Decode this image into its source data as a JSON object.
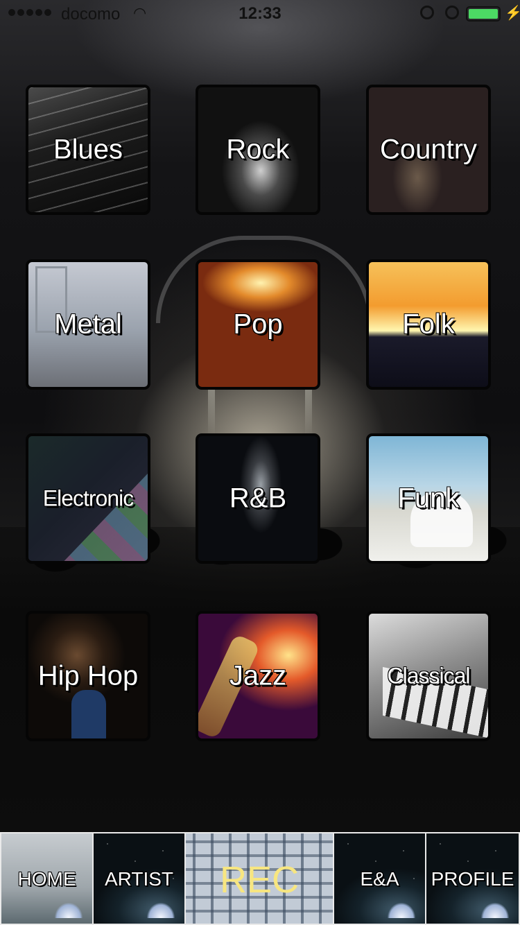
{
  "status_bar": {
    "carrier": "docomo",
    "time": "12:33",
    "battery_level": 1.0
  },
  "genres": [
    {
      "label": "Blues"
    },
    {
      "label": "Rock"
    },
    {
      "label": "Country"
    },
    {
      "label": "Metal"
    },
    {
      "label": "Pop"
    },
    {
      "label": "Folk"
    },
    {
      "label": "Electronic"
    },
    {
      "label": "R&B"
    },
    {
      "label": "Funk"
    },
    {
      "label": "Hip Hop"
    },
    {
      "label": "Jazz"
    },
    {
      "label": "Classical"
    }
  ],
  "tab_bar": {
    "home": "HOME",
    "artist": "ARTIST",
    "rec": "REC",
    "ea": "E&A",
    "profile": "PROFILE"
  },
  "colors": {
    "rec_label": "#f7e680",
    "battery": "#4cd964"
  }
}
